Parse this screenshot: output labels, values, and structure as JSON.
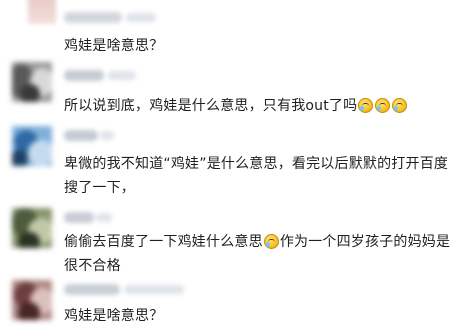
{
  "comments": [
    {
      "text": "鸡娃是啥意思？",
      "emoji_count": 0,
      "avatar_colors": [
        "#e5c3bd",
        "#f0dcd8",
        "#cfa9a4"
      ]
    },
    {
      "text": "所以说到底，鸡娃是什么意思，只有我out了吗",
      "emoji_count": 3,
      "emoji_icon": "laugh-cry-emoji-icon",
      "avatar_colors": [
        "#7a7a7a",
        "#b5b5b5",
        "#3e3e3e"
      ]
    },
    {
      "text": "卑微的我不知道“鸡娃”是什么意思，看完以后默默的打开百度搜了一下，",
      "emoji_count": 0,
      "avatar_colors": [
        "#3c7fbf",
        "#8dbbe3",
        "#2b4f73"
      ]
    },
    {
      "text_before": "偷偷去百度了一下鸡娃什么意思",
      "text_after": "作为一个四岁孩子的妈妈是很不合格",
      "emoji_count": 1,
      "emoji_icon": "laugh-cry-emoji-icon",
      "avatar_colors": [
        "#5b6b4a",
        "#a6b08d",
        "#2f3a27"
      ]
    },
    {
      "text": "鸡娃是啥意思？",
      "emoji_count": 0,
      "avatar_colors": [
        "#8a5a5a",
        "#c89a94",
        "#5a3030"
      ]
    }
  ]
}
